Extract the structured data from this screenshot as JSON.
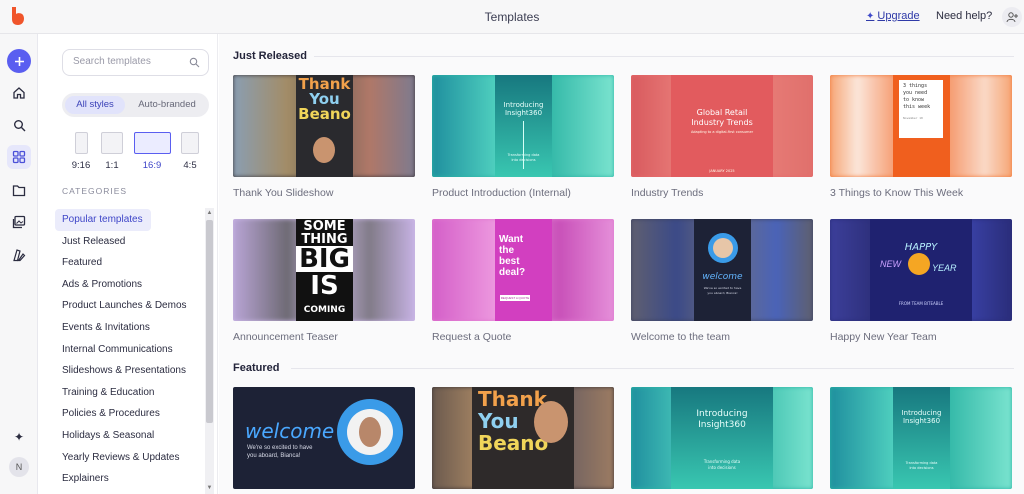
{
  "topbar": {
    "title": "Templates",
    "upgrade": "Upgrade",
    "help": "Need help?"
  },
  "rail": {
    "avatar_initial": "N"
  },
  "search": {
    "placeholder": "Search templates"
  },
  "styles": {
    "all": "All styles",
    "auto": "Auto-branded"
  },
  "ratios": [
    "9:16",
    "1:1",
    "16:9",
    "4:5"
  ],
  "categories": {
    "heading": "CATEGORIES",
    "items": [
      "Popular templates",
      "Just Released",
      "Featured",
      "Ads & Promotions",
      "Product Launches & Demos",
      "Events & Invitations",
      "Internal Communications",
      "Slideshows & Presentations",
      "Training & Education",
      "Policies & Procedures",
      "Holidays & Seasonal",
      "Yearly Reviews & Updates",
      "Explainers"
    ]
  },
  "sections": {
    "just_released": {
      "title": "Just Released",
      "cards": [
        "Thank You Slideshow",
        "Product Introduction (Internal)",
        "Industry Trends",
        "3 Things to Know This Week",
        "Announcement Teaser",
        "Request a Quote",
        "Welcome to the team",
        "Happy New Year Team"
      ]
    },
    "featured": {
      "title": "Featured"
    }
  },
  "thumb_text": {
    "thank_you": [
      "Thank",
      "You",
      "Beano",
      "!"
    ],
    "intro": [
      "Introducing",
      "Insight360",
      "Transforming data",
      "into decisions"
    ],
    "trends": [
      "Global Retail",
      "Industry Trends",
      "Adapting to a digital-first consumer",
      "JANUARY 2025"
    ],
    "three_things": [
      "3 things",
      "you need",
      "to know",
      "this week",
      "November 10"
    ],
    "teaser": [
      "SOME",
      "THING",
      "BIG",
      "IS",
      "COMING"
    ],
    "quote": [
      "Want",
      "the",
      "best",
      "deal?",
      "REQUEST A QUOTE"
    ],
    "welcome": [
      "welcome",
      "We've so excited to have",
      "you aboard, Bianca!"
    ],
    "new_year": [
      "HAPPY",
      "NEW",
      "YEAR",
      "FROM TEAM BITEABLE"
    ],
    "featured_welcome": [
      "welcome",
      "We're so excited to have",
      "you aboard, Bianca!"
    ]
  },
  "colors": {
    "accent": "#5a5ef0",
    "nav_active": "#3f46c8"
  }
}
